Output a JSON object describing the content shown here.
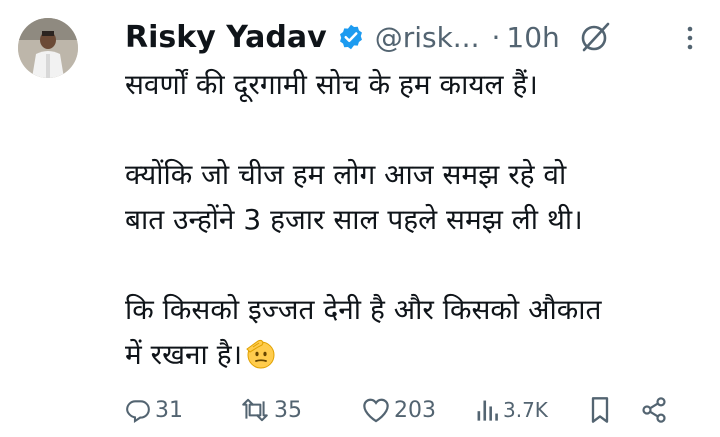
{
  "author": {
    "name": "Risky Yadav",
    "handle": "@risk...",
    "separator": "·",
    "time": "10h"
  },
  "icons": {
    "verified": "verified-badge-icon",
    "grok": "grok-icon",
    "more": "more-options-icon",
    "reply": "reply-icon",
    "retweet": "retweet-icon",
    "like": "like-icon",
    "views": "views-icon",
    "bookmark": "bookmark-icon",
    "share": "share-icon",
    "emoji": "saluting-face-emoji"
  },
  "tweet": {
    "line1": "सवर्णों की दूरगामी सोच के हम कायल हैं।",
    "line2": "क्योंकि जो चीज हम लोग आज समझ रहे वो",
    "line3": "बात उन्होंने 3 हजार साल पहले समझ ली थी।",
    "line4": "कि किसको इज्जत देनी है और किसको औकात",
    "line5": "में रखना है।"
  },
  "stats": {
    "replies": "31",
    "retweets": "35",
    "likes": "203",
    "views": "3.7K"
  },
  "colors": {
    "text": "#0f1419",
    "secondary": "#536471",
    "verified": "#1d9bf0"
  }
}
